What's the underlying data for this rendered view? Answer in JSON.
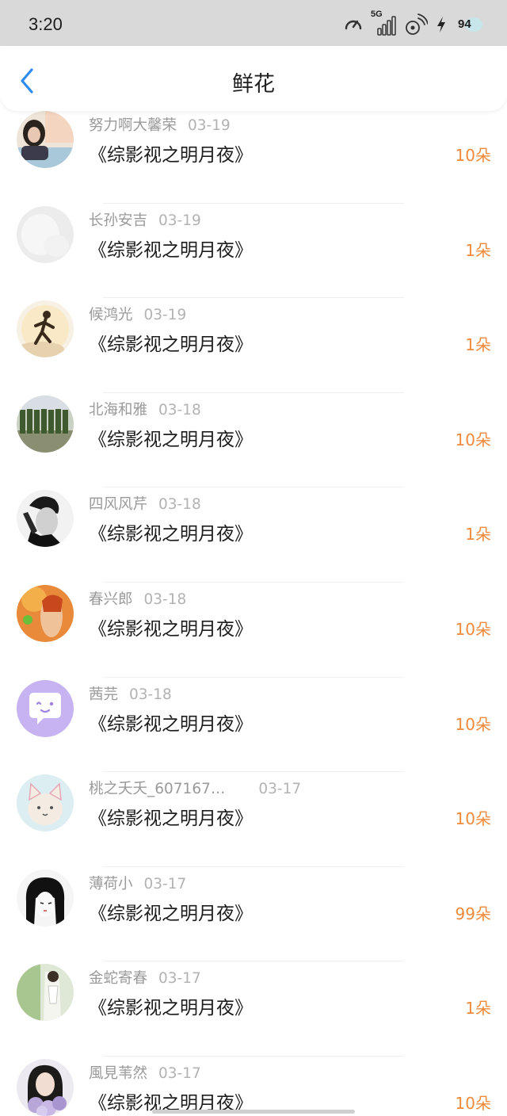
{
  "status_bar": {
    "time": "3:20",
    "network": "5G",
    "battery": "94"
  },
  "header": {
    "title": "鲜花"
  },
  "colors": {
    "accent": "#f08a3c",
    "back_arrow": "#2d8cf0"
  },
  "items": [
    {
      "user": "努力啊大馨荣",
      "date": "03-19",
      "title": "《综影视之明月夜》",
      "count": "10朵",
      "avatar": "avatar-photo-room"
    },
    {
      "user": "长孙安吉",
      "date": "03-19",
      "title": "《综影视之明月夜》",
      "count": "1朵",
      "avatar": "avatar-blank-white"
    },
    {
      "user": "候鸿光",
      "date": "03-19",
      "title": "《综影视之明月夜》",
      "count": "1朵",
      "avatar": "avatar-runner-sunset"
    },
    {
      "user": "北海和雅",
      "date": "03-18",
      "title": "《综影视之明月夜》",
      "count": "10朵",
      "avatar": "avatar-soldiers"
    },
    {
      "user": "四风风芹",
      "date": "03-18",
      "title": "《综影视之明月夜》",
      "count": "1朵",
      "avatar": "avatar-man-bw"
    },
    {
      "user": "春兴郎",
      "date": "03-18",
      "title": "《综影视之明月夜》",
      "count": "10朵",
      "avatar": "avatar-game-art"
    },
    {
      "user": "茜芫",
      "date": "03-18",
      "title": "《综影视之明月夜》",
      "count": "10朵",
      "avatar": "avatar-default-purple"
    },
    {
      "user": "桃之夭夭_607167…",
      "date": "03-17",
      "title": "《综影视之明月夜》",
      "count": "10朵",
      "avatar": "avatar-cat"
    },
    {
      "user": "薄荷小",
      "date": "03-17",
      "title": "《综影视之明月夜》",
      "count": "99朵",
      "avatar": "avatar-anime-girl"
    },
    {
      "user": "金蛇寄春",
      "date": "03-17",
      "title": "《综影视之明月夜》",
      "count": "1朵",
      "avatar": "avatar-green-drawing"
    },
    {
      "user": "風見苇然",
      "date": "03-17",
      "title": "《综影视之明月夜》",
      "count": "10朵",
      "avatar": "avatar-girl-flowers"
    }
  ]
}
